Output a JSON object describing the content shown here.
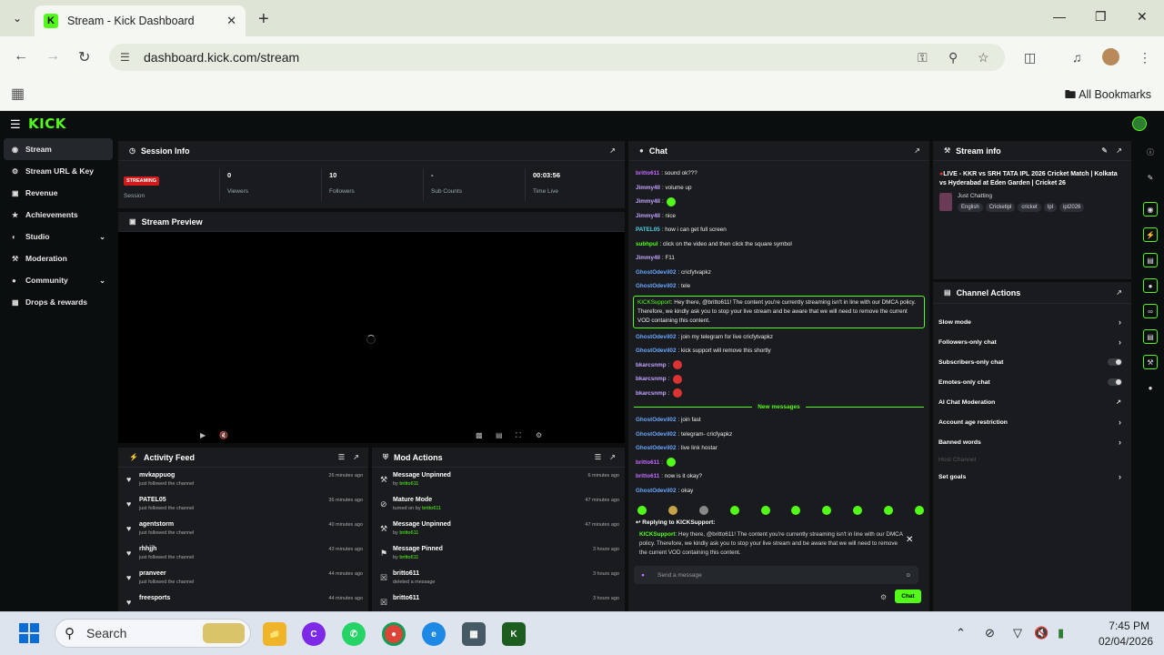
{
  "browser": {
    "tab_title": "Stream - Kick Dashboard",
    "url": "dashboard.kick.com/stream",
    "bookmarks_label": "All Bookmarks",
    "favicon_letter": "K"
  },
  "kick": {
    "logo": "KICK",
    "accent": "#53fc18"
  },
  "sidebar": {
    "items": [
      {
        "label": "Stream",
        "icon": "broadcast-icon"
      },
      {
        "label": "Stream URL & Key",
        "icon": "key-icon"
      },
      {
        "label": "Revenue",
        "icon": "revenue-icon"
      },
      {
        "label": "Achievements",
        "icon": "trophy-icon"
      },
      {
        "label": "Studio",
        "icon": "studio-icon"
      },
      {
        "label": "Moderation",
        "icon": "wrench-icon"
      },
      {
        "label": "Community",
        "icon": "community-icon"
      },
      {
        "label": "Drops & rewards",
        "icon": "gift-icon"
      }
    ]
  },
  "session": {
    "title": "Session Info",
    "status_badge": "STREAMING",
    "status_label": "Session",
    "viewers_value": "0",
    "viewers_label": "Viewers",
    "followers_value": "10",
    "followers_label": "Followers",
    "subs_value": "-",
    "subs_label": "Sub Counts",
    "time_value": "00:03:56",
    "time_label": "Time Live"
  },
  "preview": {
    "title": "Stream Preview"
  },
  "activity": {
    "title": "Activity Feed",
    "rows": [
      {
        "name": "mvkappuog",
        "sub": "just followed the channel",
        "time": "26 minutes ago"
      },
      {
        "name": "PATEL05",
        "sub": "just followed the channel",
        "time": "36 minutes ago"
      },
      {
        "name": "agentstorm",
        "sub": "just followed the channel",
        "time": "40 minutes ago"
      },
      {
        "name": "rhhjjh",
        "sub": "just followed the channel",
        "time": "43 minutes ago"
      },
      {
        "name": "pranveer",
        "sub": "just followed the channel",
        "time": "44 minutes ago"
      },
      {
        "name": "freesports",
        "sub": "",
        "time": "44 minutes ago"
      }
    ]
  },
  "mod": {
    "title": "Mod Actions",
    "rows": [
      {
        "name": "Message Unpinned",
        "pre": "by ",
        "user": "britto611",
        "time": "6 minutes ago"
      },
      {
        "name": "Mature Mode",
        "pre": "turned on by ",
        "user": "britto611",
        "time": "47 minutes ago"
      },
      {
        "name": "Message Unpinned",
        "pre": "by ",
        "user": "britto611",
        "time": "47 minutes ago"
      },
      {
        "name": "Message Pinned",
        "pre": "by ",
        "user": "britto611",
        "time": "3 hours ago"
      },
      {
        "name": "britto611",
        "pre": "deleted a message",
        "user": "",
        "time": "3 hours ago"
      },
      {
        "name": "britto611",
        "pre": "",
        "user": "",
        "time": "3 hours ago"
      }
    ]
  },
  "chat": {
    "title": "Chat",
    "messages": [
      {
        "user": "britto611",
        "text": "sound ok???",
        "color": "#c56bff"
      },
      {
        "user": "Jimmy4ll",
        "text": "volume up",
        "color": "#c3a3ff"
      },
      {
        "user": "Jimmy4ll",
        "text": "",
        "color": "#c3a3ff",
        "emote": "#53fc18"
      },
      {
        "user": "Jimmy4ll",
        "text": "nice",
        "color": "#c3a3ff"
      },
      {
        "user": "PATEL05",
        "text": "how i can get full screen",
        "color": "#4fd1e8"
      },
      {
        "user": "subhpul",
        "text": "click on the video and then click the square symbol",
        "color": "#53fc18"
      },
      {
        "user": "Jimmy4ll",
        "text": "F11",
        "color": "#c3a3ff"
      },
      {
        "user": "GhostOdevil02",
        "text": "cricfytvapkz",
        "color": "#6aa8ff"
      },
      {
        "user": "GhostOdevil02",
        "text": "tele",
        "color": "#6aa8ff"
      }
    ],
    "kick_user": "KICKSupport",
    "kick_text": "Hey there, @britto611! The content you're currently streaming isn't in line with our DMCA policy. Therefore, we kindly ask you to stop your live stream and be aware that we will need to remove the current VOD containing this content.",
    "messages2": [
      {
        "user": "GhostOdevil02",
        "text": "join my telegram for live cricfytvapkz",
        "color": "#6aa8ff"
      },
      {
        "user": "GhostOdevil02",
        "text": "kick support will remove this shortly",
        "color": "#6aa8ff"
      },
      {
        "user": "bkarcsnmp",
        "text": "",
        "color": "#c3a3ff",
        "emote": "#d33"
      },
      {
        "user": "bkarcsnmp",
        "text": "",
        "color": "#c3a3ff",
        "emote": "#d33"
      },
      {
        "user": "bkarcsnmp",
        "text": "",
        "color": "#c3a3ff",
        "emote": "#d33"
      }
    ],
    "new_messages_label": "New messages",
    "messages3": [
      {
        "user": "GhostOdevil02",
        "text": "join fast",
        "color": "#6aa8ff"
      },
      {
        "user": "GhostOdevil02",
        "text": "telegram- cricfyapkz",
        "color": "#6aa8ff"
      },
      {
        "user": "GhostOdevil02",
        "text": "live link hostar",
        "color": "#6aa8ff"
      },
      {
        "user": "britto611",
        "text": "",
        "color": "#c56bff",
        "emote": "#53fc18"
      },
      {
        "user": "britto611",
        "text": "now is it okay?",
        "color": "#c56bff"
      },
      {
        "user": "GhostOdevil02",
        "text": "okay",
        "color": "#6aa8ff"
      }
    ],
    "replying_label": "Replying to KICKSupport:",
    "input_placeholder": "Send a message",
    "send_label": "Chat"
  },
  "stream_info": {
    "title": "Stream info",
    "stream_title": "LIVE - KKR vs SRH TATA IPL 2026 Cricket Match | Kolkata vs Hyderabad at Eden Garden | Cricket 26",
    "category": "Just Chatting",
    "tags": [
      "English",
      "Cricketipl",
      "cricket",
      "Ipl",
      "ipl2026"
    ]
  },
  "channel_actions": {
    "title": "Channel Actions",
    "items": [
      {
        "label": "Slow mode",
        "control": "arrow"
      },
      {
        "label": "Followers-only chat",
        "control": "arrow"
      },
      {
        "label": "Subscribers-only chat",
        "control": "toggle"
      },
      {
        "label": "Emotes-only chat",
        "control": "toggle"
      },
      {
        "label": "AI Chat Moderation",
        "control": "external"
      },
      {
        "label": "Account age restriction",
        "control": "arrow"
      },
      {
        "label": "Banned words",
        "control": "arrow"
      }
    ],
    "host_label": "Host Channel",
    "goals_label": "Set goals"
  },
  "taskbar": {
    "search_label": "Search",
    "time": "7:45 PM",
    "date": "02/04/2026"
  }
}
